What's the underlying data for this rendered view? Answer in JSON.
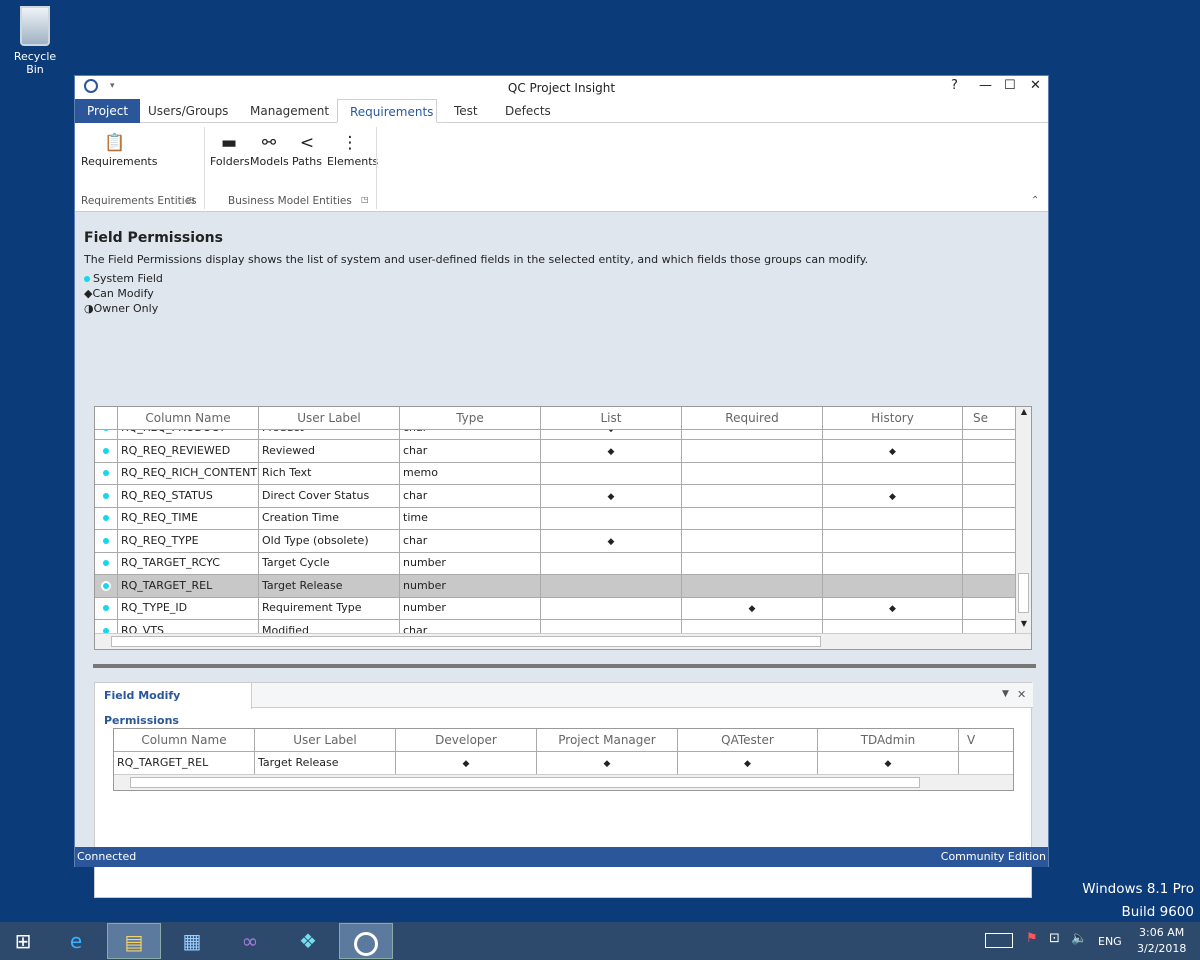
{
  "desktop": {
    "recycle_bin": "Recycle Bin",
    "watermark": [
      "Windows 8.1 Pro",
      "Build 9600"
    ]
  },
  "window": {
    "title": "QC Project Insight",
    "help": "?",
    "minimize": "—",
    "maximize": "☐",
    "close": "✕"
  },
  "tabs": [
    "Project",
    "Users/Groups",
    "Management",
    "Requirements",
    "Test",
    "Defects"
  ],
  "ribbon": {
    "buttons": [
      {
        "label": "Requirements",
        "icon": "clipboard-check-icon"
      },
      {
        "label": "Folders",
        "icon": "folder-icon"
      },
      {
        "label": "Models",
        "icon": "model-icon"
      },
      {
        "label": "Paths",
        "icon": "paths-icon"
      },
      {
        "label": "Elements",
        "icon": "elements-icon"
      }
    ],
    "groups": [
      "Requirements Entities",
      "Business Model Entities"
    ]
  },
  "field_permissions": {
    "title": "Field Permissions",
    "description": "The Field Permissions display shows the list of system and user-defined fields in the selected entity, and which fields those groups can modify.",
    "legend": [
      "System Field",
      "Can Modify",
      "Owner Only"
    ],
    "columns": [
      "Column Name",
      "User Label",
      "Type",
      "List",
      "Required",
      "History",
      "Se"
    ],
    "rows": [
      {
        "name": "RQ_REQ_PRODUCT",
        "label": "Product",
        "type": "char",
        "list": true,
        "required": false,
        "history": false
      },
      {
        "name": "RQ_REQ_REVIEWED",
        "label": "Reviewed",
        "type": "char",
        "list": true,
        "required": false,
        "history": true
      },
      {
        "name": "RQ_REQ_RICH_CONTENT",
        "label": "Rich Text",
        "type": "memo",
        "list": false,
        "required": false,
        "history": false
      },
      {
        "name": "RQ_REQ_STATUS",
        "label": "Direct Cover Status",
        "type": "char",
        "list": true,
        "required": false,
        "history": true
      },
      {
        "name": "RQ_REQ_TIME",
        "label": "Creation Time",
        "type": "time",
        "list": false,
        "required": false,
        "history": false
      },
      {
        "name": "RQ_REQ_TYPE",
        "label": "Old Type (obsolete)",
        "type": "char",
        "list": true,
        "required": false,
        "history": false
      },
      {
        "name": "RQ_TARGET_RCYC",
        "label": "Target Cycle",
        "type": "number",
        "list": false,
        "required": false,
        "history": false
      },
      {
        "name": "RQ_TARGET_REL",
        "label": "Target Release",
        "type": "number",
        "list": false,
        "required": false,
        "history": false,
        "selected": true
      },
      {
        "name": "RQ_TYPE_ID",
        "label": "Requirement Type",
        "type": "number",
        "list": false,
        "required": true,
        "history": true
      },
      {
        "name": "RQ_VTS",
        "label": "Modified",
        "type": "char",
        "list": false,
        "required": false,
        "history": false
      }
    ]
  },
  "modify_permissions": {
    "tab": "Field Modify Permissions",
    "columns": [
      "Column Name",
      "User Label",
      "Developer",
      "Project Manager",
      "QATester",
      "TDAdmin",
      "V"
    ],
    "rows": [
      {
        "name": "RQ_TARGET_REL",
        "label": "Target Release",
        "perms": [
          true,
          true,
          true,
          true
        ]
      }
    ]
  },
  "status": {
    "left": "Connected",
    "right": "Community Edition"
  },
  "tray": {
    "lang": "ENG",
    "time": "3:06 AM",
    "date": "3/2/2018"
  },
  "colors": {
    "accent": "#2b579a",
    "system_field": "#13d6ef",
    "desktop": "#0b3b78"
  }
}
